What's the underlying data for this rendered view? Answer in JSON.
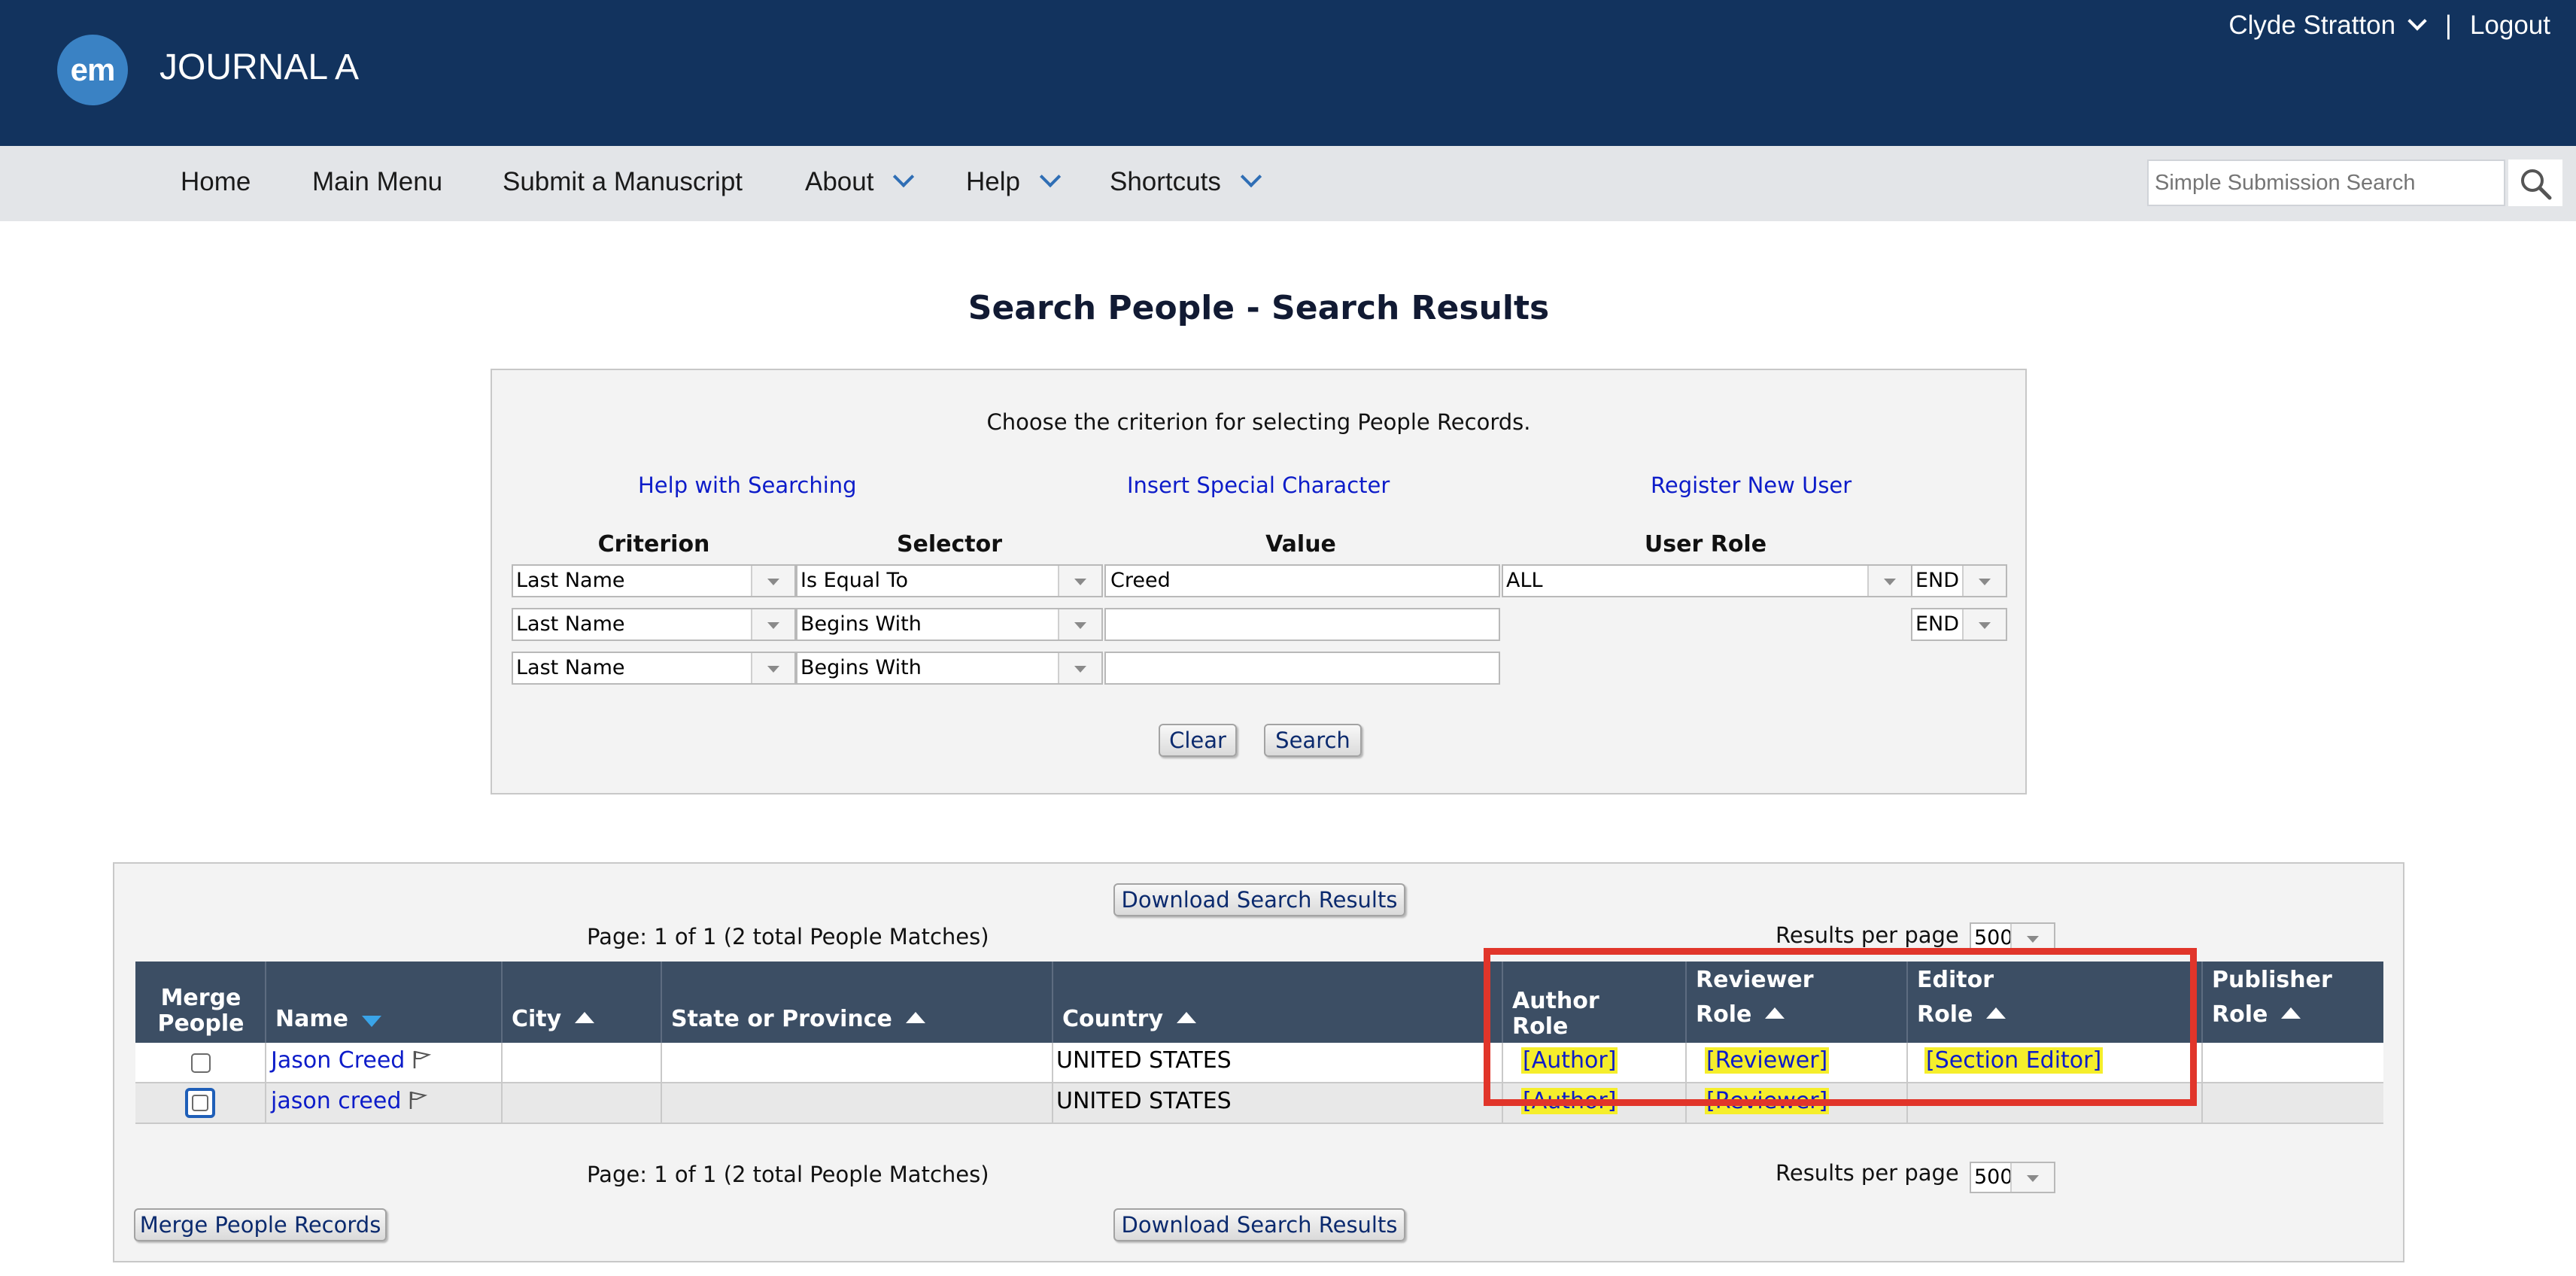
{
  "header": {
    "logo_text": "em",
    "journal_name": "JOURNAL A",
    "user_name": "Clyde Stratton",
    "separator": "|",
    "logout_label": "Logout"
  },
  "nav": {
    "items": [
      {
        "label": "Home",
        "has_dropdown": false
      },
      {
        "label": "Main Menu",
        "has_dropdown": false
      },
      {
        "label": "Submit a Manuscript",
        "has_dropdown": false
      },
      {
        "label": "About",
        "has_dropdown": true
      },
      {
        "label": "Help",
        "has_dropdown": true
      },
      {
        "label": "Shortcuts",
        "has_dropdown": true
      }
    ],
    "search_placeholder": "Simple Submission Search"
  },
  "page": {
    "title": "Search People - Search Results"
  },
  "search_panel": {
    "instruction": "Choose the criterion for selecting People Records.",
    "links": {
      "help": "Help with Searching",
      "special_char": "Insert Special Character",
      "register": "Register New User"
    },
    "headers": {
      "criterion": "Criterion",
      "selector": "Selector",
      "value": "Value",
      "user_role": "User Role"
    },
    "rows": [
      {
        "criterion": "Last Name",
        "selector": "Is Equal To",
        "value": "Creed",
        "user_role": "ALL",
        "end": "END"
      },
      {
        "criterion": "Last Name",
        "selector": "Begins With",
        "value": "",
        "end": "END"
      },
      {
        "criterion": "Last Name",
        "selector": "Begins With",
        "value": ""
      }
    ],
    "clear_label": "Clear",
    "search_label": "Search"
  },
  "results": {
    "download_label": "Download Search Results",
    "page_info": "Page: 1 of 1 (2 total People Matches)",
    "results_per_page_label": "Results per page",
    "results_per_page_value": "500",
    "merge_label": "Merge People Records",
    "columns": {
      "merge": "Merge People",
      "name": "Name",
      "city": "City",
      "state": "State or Province",
      "country": "Country",
      "author": "Author Role",
      "reviewer": "Reviewer Role",
      "editor": "Editor Role",
      "publisher": "Publisher Role"
    },
    "rows": [
      {
        "name": "Jason Creed",
        "city": "",
        "state": "",
        "country": "UNITED STATES",
        "author": "[Author]",
        "reviewer": "[Reviewer]",
        "editor": "[Section Editor]",
        "publisher": ""
      },
      {
        "name": "jason creed",
        "city": "",
        "state": "",
        "country": "UNITED STATES",
        "author": "[Author]",
        "reviewer": "[Reviewer]",
        "editor": "",
        "publisher": ""
      }
    ]
  },
  "colors": {
    "header_bg": "#12335e",
    "nav_bg": "#e3e5e8",
    "table_header_bg": "#3c4e64",
    "link": "#0d1cc9",
    "role_highlight": "#f5ee2b",
    "annotation_red": "#e1352a"
  }
}
